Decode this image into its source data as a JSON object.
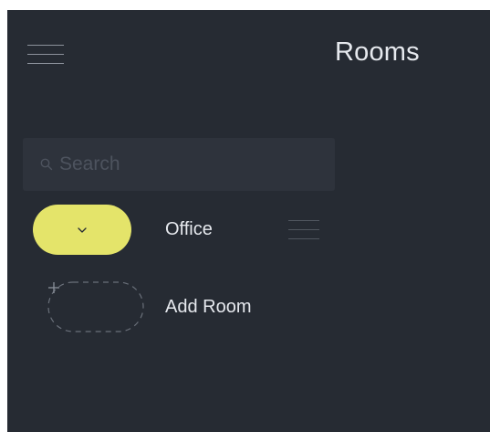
{
  "header": {
    "title": "Rooms",
    "menu_icon": "hamburger-menu-icon"
  },
  "search": {
    "placeholder": "Search",
    "value": "",
    "icon": "search-icon"
  },
  "rooms": [
    {
      "label": "Office",
      "toggle_icon": "chevron-down-icon",
      "handle_icon": "drag-handle-icon"
    }
  ],
  "add_room": {
    "label": "Add Room",
    "icon": "plus-icon"
  },
  "colors": {
    "background": "#262b33",
    "search_background": "#2e333c",
    "accent": "#e4e46a",
    "text": "#e6e9ee",
    "muted": "#4d535e"
  }
}
